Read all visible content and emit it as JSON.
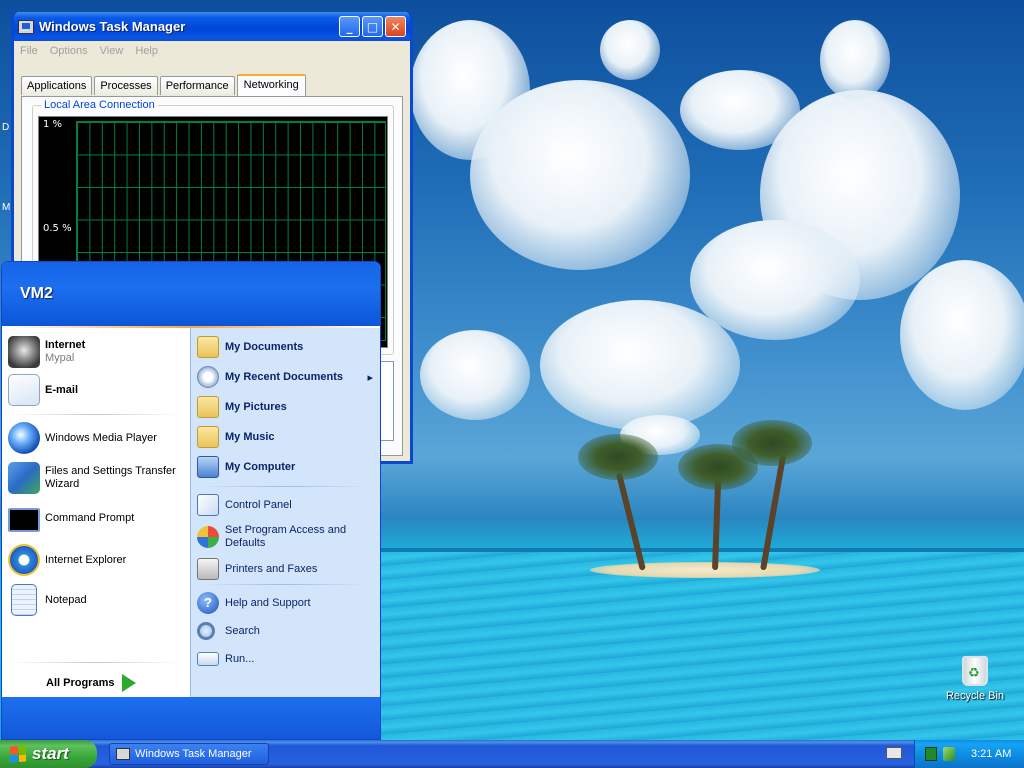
{
  "desktop": {
    "icons": [
      {
        "label": "Recycle Bin",
        "icon": "recycle-bin-icon"
      }
    ]
  },
  "task_manager": {
    "title": "Windows Task Manager",
    "menu": [
      "File",
      "Options",
      "View",
      "Help"
    ],
    "tabs": [
      "Applications",
      "Processes",
      "Performance",
      "Networking"
    ],
    "active_tab": "Networking",
    "group_label": "Local Area Connection",
    "graph_labels": [
      "1 %",
      "0.5 %"
    ],
    "buttons": {
      "minimize": "_",
      "maximize": "□",
      "close": "✕"
    }
  },
  "start_menu": {
    "user": "VM2",
    "pinned": [
      {
        "label": "Internet",
        "sublabel": "Mypal",
        "icon": "mypal-raccoon-icon"
      },
      {
        "label": "E-mail",
        "icon": "email-envelope-icon"
      }
    ],
    "recent": [
      {
        "label": "Windows Media Player",
        "icon": "media-player-icon"
      },
      {
        "label": "Files and Settings Transfer Wizard",
        "icon": "transfer-wizard-icon"
      },
      {
        "label": "Command Prompt",
        "icon": "command-prompt-icon"
      },
      {
        "label": "Internet Explorer",
        "icon": "internet-explorer-icon"
      },
      {
        "label": "Notepad",
        "icon": "notepad-icon"
      }
    ],
    "all_programs": "All Programs",
    "right": [
      {
        "label": "My Documents",
        "icon": "folder-documents-icon"
      },
      {
        "label": "My Recent Documents",
        "icon": "recent-documents-icon",
        "submenu_arrow": "▸"
      },
      {
        "label": "My Pictures",
        "icon": "folder-pictures-icon"
      },
      {
        "label": "My Music",
        "icon": "folder-music-icon"
      },
      {
        "label": "My Computer",
        "icon": "computer-icon"
      },
      {
        "label": "Control Panel",
        "icon": "control-panel-icon"
      },
      {
        "label": "Set Program Access and Defaults",
        "icon": "program-defaults-icon"
      },
      {
        "label": "Printers and Faxes",
        "icon": "printer-icon"
      },
      {
        "label": "Help and Support",
        "icon": "help-icon"
      },
      {
        "label": "Search",
        "icon": "search-icon"
      },
      {
        "label": "Run...",
        "icon": "run-icon"
      }
    ]
  },
  "taskbar": {
    "start_label": "start",
    "task_buttons": [
      {
        "label": "Windows Task Manager"
      }
    ],
    "clock": "3:21 AM"
  },
  "colors": {
    "start_green": "#39a83a",
    "taskbar_blue": "#2663e0",
    "tray_blue": "#0b89e0",
    "graph_grid": "#008040"
  }
}
